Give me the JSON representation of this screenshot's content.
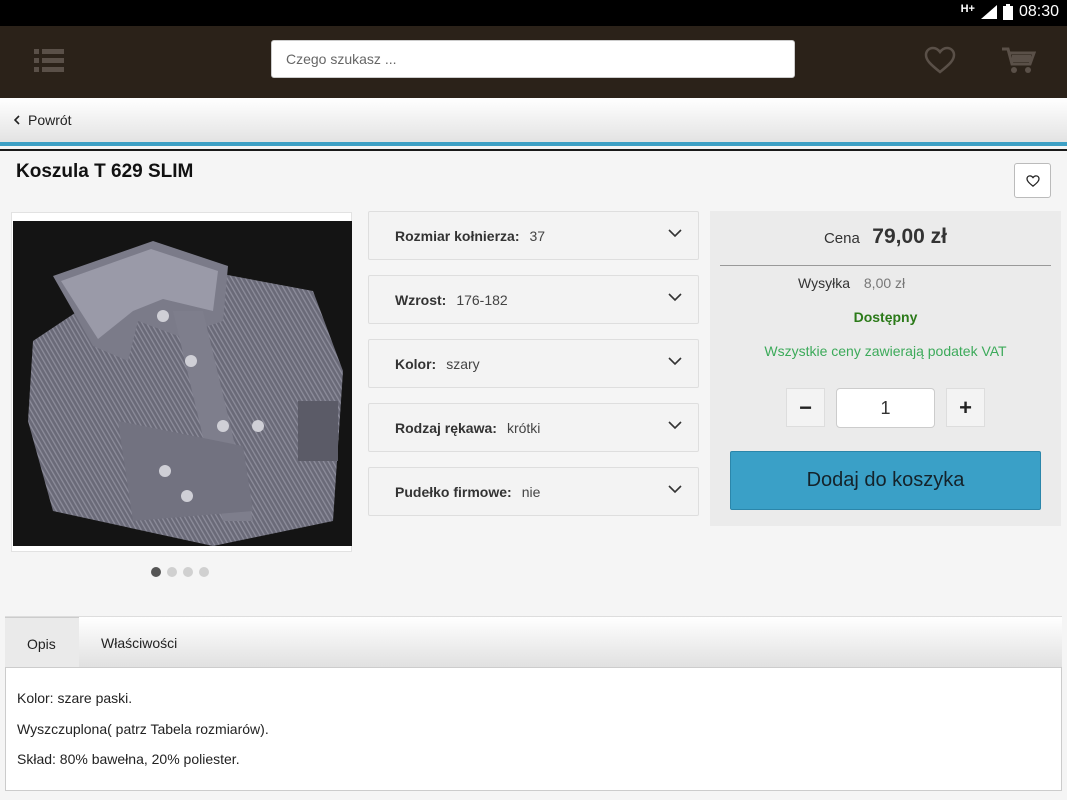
{
  "status_bar": {
    "network": "H+",
    "time": "08:30"
  },
  "header": {
    "search_placeholder": "Czego szukasz ..."
  },
  "nav": {
    "back_label": "Powrót"
  },
  "product": {
    "title": "Koszula T 629 SLIM",
    "gallery": {
      "image_count": 4,
      "active_index": 0
    },
    "options": [
      {
        "label": "Rozmiar kołnierza:",
        "value": "37"
      },
      {
        "label": "Wzrost:",
        "value": "176-182"
      },
      {
        "label": "Kolor:",
        "value": "szary"
      },
      {
        "label": "Rodzaj rękawa:",
        "value": "krótki"
      },
      {
        "label": "Pudełko firmowe:",
        "value": "nie"
      }
    ],
    "price": {
      "price_label": "Cena",
      "price_value": "79,00 zł",
      "shipping_label": "Wysyłka",
      "shipping_value": "8,00 zł",
      "availability": "Dostępny",
      "vat_note": "Wszystkie ceny zawierają podatek VAT",
      "quantity": "1",
      "minus_label": "−",
      "plus_label": "+",
      "add_to_cart_label": "Dodaj do koszyka"
    }
  },
  "tabs": [
    {
      "label": "Opis",
      "active": true
    },
    {
      "label": "Właściwości",
      "active": false
    }
  ],
  "description": [
    "Kolor: szare paski.",
    "Wyszczuplona( patrz Tabela rozmiarów).",
    "Skład: 80% bawełna, 20% poliester."
  ],
  "colors": {
    "header_bg": "#2b2219",
    "accent": "#3aa0c7",
    "available": "#2b7a19",
    "vat": "#3caa5a"
  }
}
